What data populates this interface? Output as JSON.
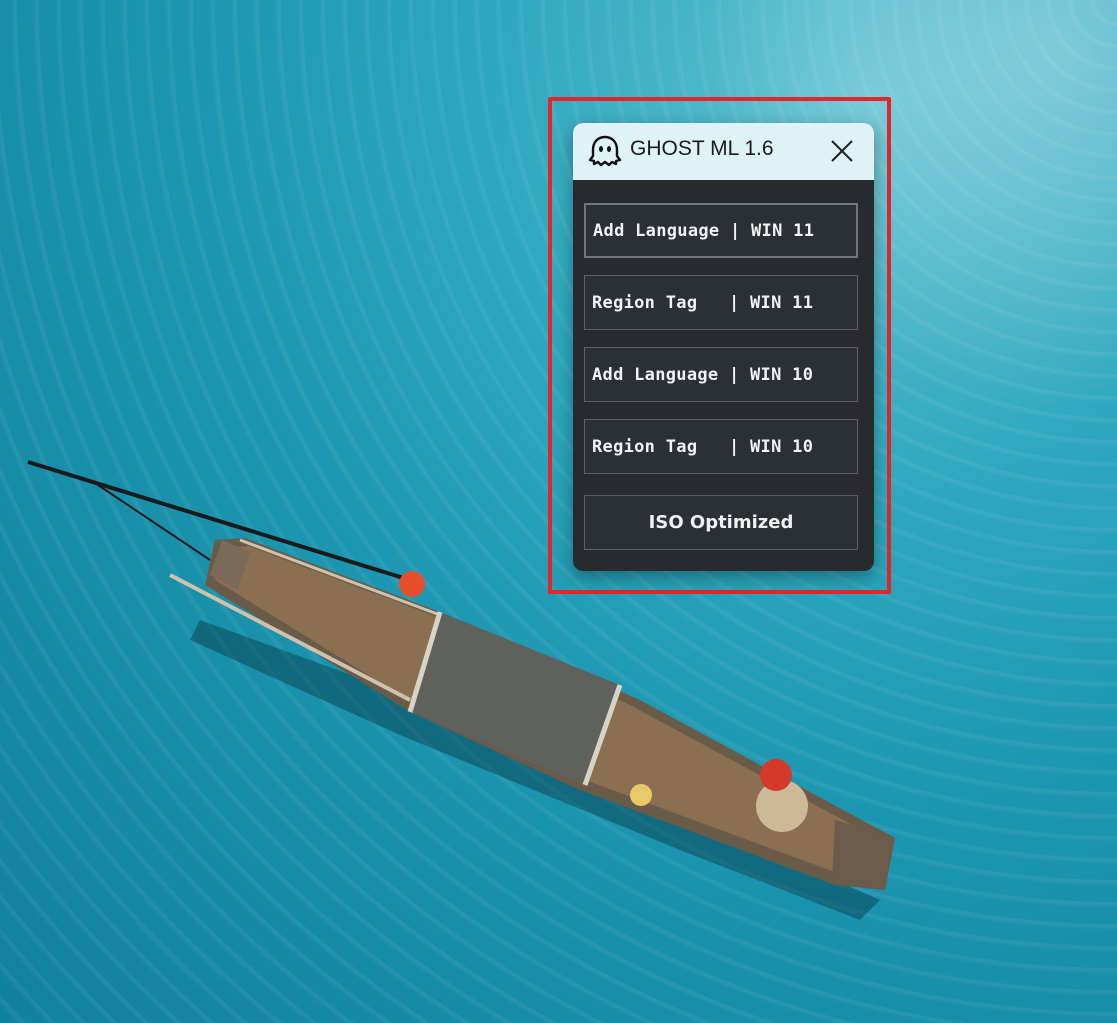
{
  "window": {
    "title": "GHOST ML 1.6",
    "icon": "ghost-icon",
    "close_icon": "close-icon"
  },
  "buttons": [
    {
      "label": "Add Language | WIN 11"
    },
    {
      "label": "Region Tag   | WIN 11"
    },
    {
      "label": "Add Language | WIN 10"
    },
    {
      "label": "Region Tag   | WIN 10"
    },
    {
      "label": "ISO Optimized"
    }
  ],
  "colors": {
    "highlight": "#e3262a",
    "titlebar": "#dff2f6",
    "panel": "#272b2e",
    "water": "#1c96b0"
  }
}
